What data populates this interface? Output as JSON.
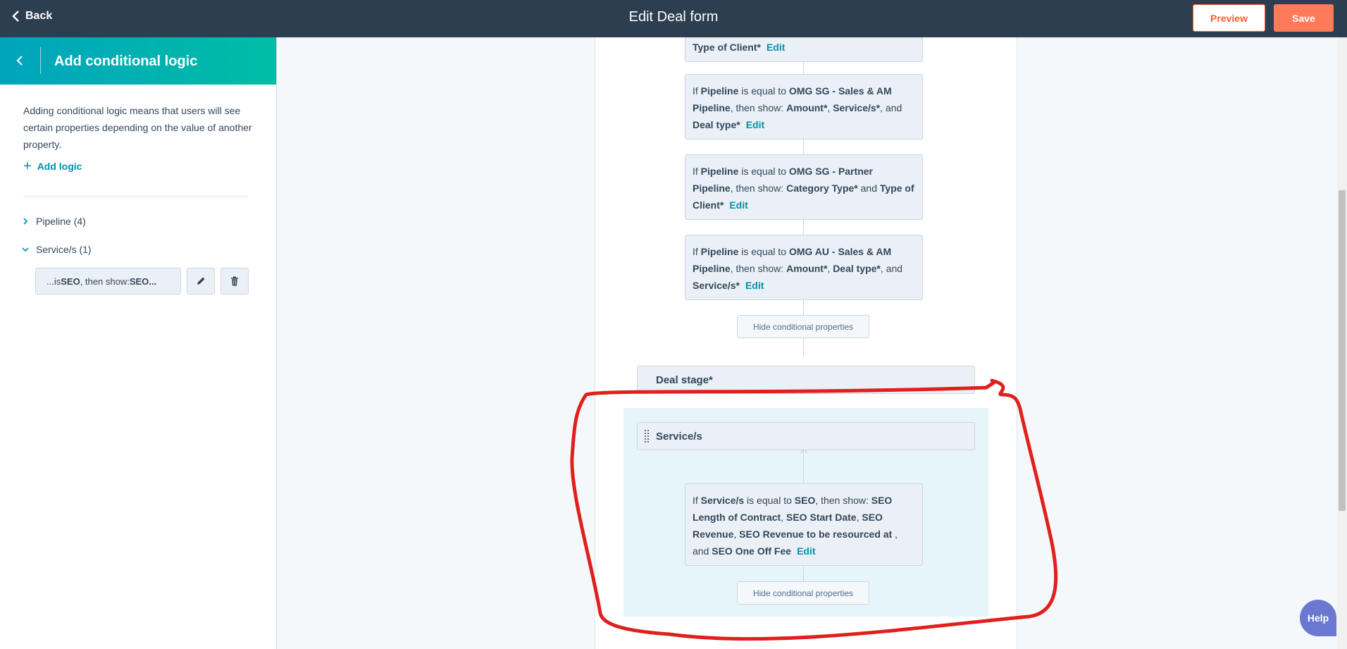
{
  "topbar": {
    "back_label": "Back",
    "title": "Edit Deal form",
    "preview_label": "Preview",
    "save_label": "Save"
  },
  "sidebar": {
    "title": "Add conditional logic",
    "description": "Adding conditional logic means that users will see certain properties depending on the value of another property.",
    "add_logic_label": "Add logic",
    "groups": [
      {
        "label": "Pipeline (4)",
        "expanded": false
      },
      {
        "label": "Service/s (1)",
        "expanded": true
      }
    ],
    "rule_chip": {
      "prefix": "...is ",
      "value": "SEO",
      "middle": ", then show: ",
      "tail": "SEO..."
    }
  },
  "canvas": {
    "top_partial": {
      "prop": "Type of Client*",
      "edit": "Edit"
    },
    "conditions": [
      {
        "if": "If ",
        "field": "Pipeline",
        "op": " is equal to ",
        "value": "OMG SG - Sales & AM Pipeline",
        "then": ", then show: ",
        "p1": "Amount*",
        "sep1": ", ",
        "p2": "Service/s*",
        "sep2": ", and ",
        "p3": "Deal type*",
        "edit": "Edit"
      },
      {
        "if": "If ",
        "field": "Pipeline",
        "op": " is equal to ",
        "value": "OMG SG - Partner Pipeline",
        "then": ", then show: ",
        "p1": "Category Type*",
        "sep1": " and ",
        "p2": "Type of Client*",
        "edit": "Edit"
      },
      {
        "if": "If ",
        "field": "Pipeline",
        "op": " is equal to ",
        "value": "OMG AU - Sales & AM Pipeline",
        "then": ", then show: ",
        "p1": "Amount*",
        "sep1": ", ",
        "p2": "Deal type*",
        "sep2": ", and ",
        "p3": "Service/s*",
        "edit": "Edit"
      }
    ],
    "hide_label": "Hide conditional properties",
    "deal_stage": "Deal stage*",
    "service_prop": "Service/s",
    "service_condition": {
      "if": "If ",
      "field": "Service/s",
      "op": " is equal to ",
      "value": "SEO",
      "then": ", then show: ",
      "p1": "SEO Length of Contract",
      "sep1": ", ",
      "p2": "SEO Start Date",
      "sep2": ", ",
      "p3": "SEO Revenue",
      "sep3": ", ",
      "p4": "SEO Revenue to be resourced at ",
      "sep4": ", and ",
      "p5": "SEO One Off Fee",
      "edit": "Edit"
    }
  },
  "help_label": "Help",
  "colors": {
    "topbar": "#2d3e50",
    "accent": "#ff7a59",
    "teal": "#00a4bd",
    "link": "#0091ae",
    "annotation": "#e0201c"
  }
}
